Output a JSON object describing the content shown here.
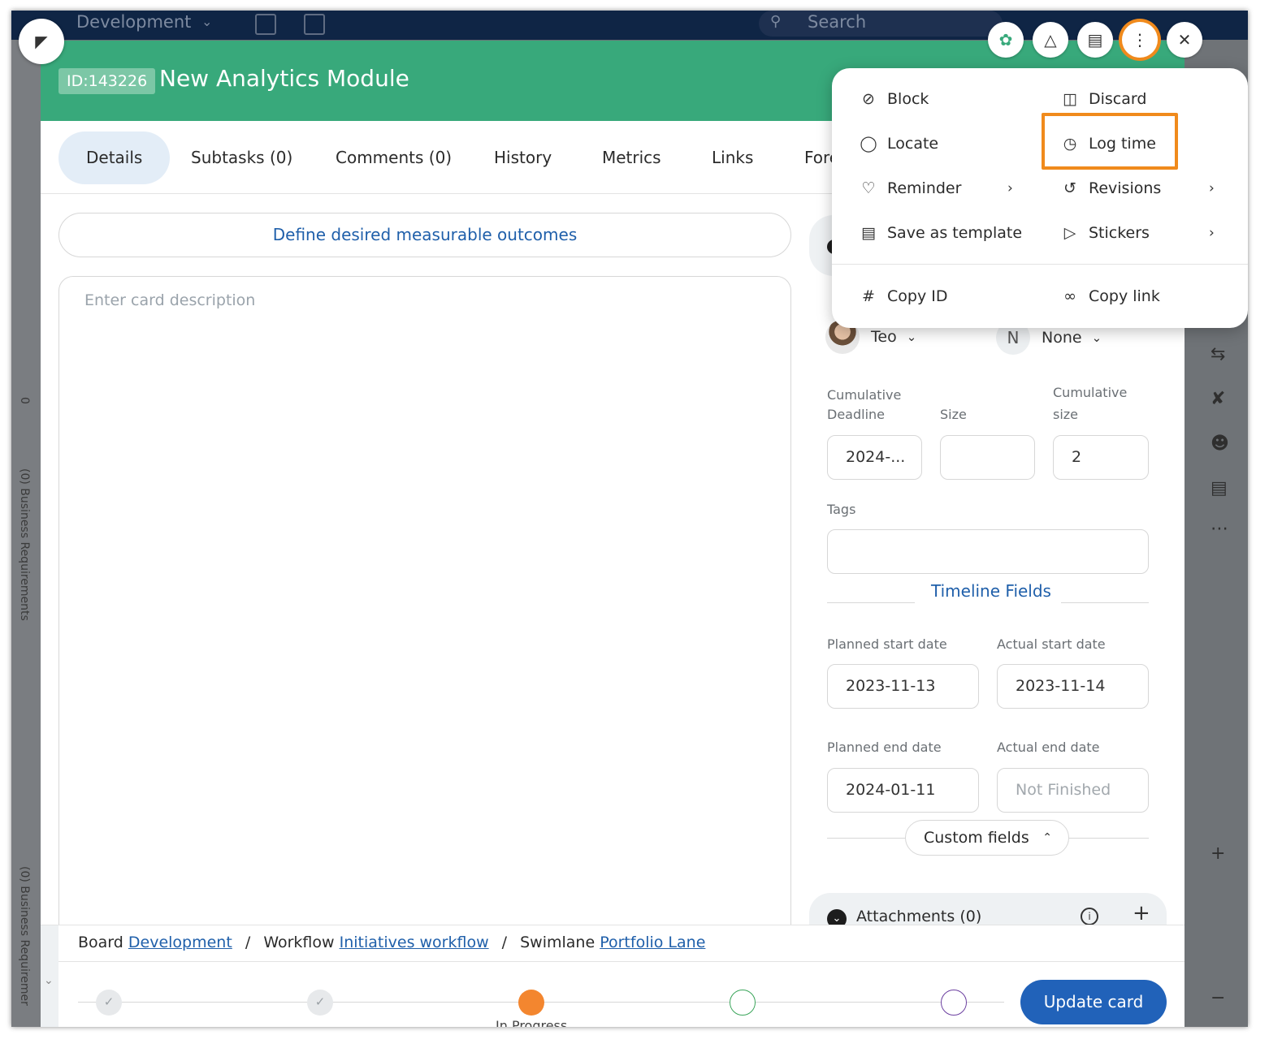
{
  "background": {
    "board_name": "Development",
    "search_placeholder": "Search",
    "left_column_labels": [
      "(0) Business Requirements",
      "(0) Business Requiremer"
    ],
    "left_column_count": "0"
  },
  "header": {
    "card_id": "ID:143226",
    "card_title": "New Analytics Module",
    "color": "#38a97b"
  },
  "tabs": [
    {
      "label": "Details",
      "active": true
    },
    {
      "label": "Subtasks (0)"
    },
    {
      "label": "Comments (0)"
    },
    {
      "label": "History"
    },
    {
      "label": "Metrics"
    },
    {
      "label": "Links"
    },
    {
      "label": "Fore"
    }
  ],
  "main": {
    "outcomes_button": "Define desired measurable outcomes",
    "description_placeholder": "Enter card description"
  },
  "right_panel": {
    "assignee_name": "Teo",
    "secondary_initial": "N",
    "secondary_value": "None",
    "deadline_label": "Deadline",
    "deadline_value": "2024-...",
    "size_label": "Size",
    "size_value": "",
    "cumulative_size_label_1": "Cumulative",
    "cumulative_size_label_2": "size",
    "cumulative_size_value": "2",
    "tags_label": "Tags",
    "timeline_title": "Timeline Fields",
    "planned_start_label": "Planned start date",
    "planned_start_value": "2023-11-13",
    "actual_start_label": "Actual start date",
    "actual_start_value": "2023-11-14",
    "planned_end_label": "Planned end date",
    "planned_end_value": "2024-01-11",
    "actual_end_label": "Actual end date",
    "actual_end_placeholder": "Not Finished",
    "custom_fields_label": "Custom fields",
    "attachments_label": "Attachments (0)"
  },
  "footer": {
    "board_label": "Board",
    "board_link": "Development",
    "workflow_label": "Workflow",
    "workflow_link": "Initiatives workflow",
    "swimlane_label": "Swimlane",
    "swimlane_link": "Portfolio Lane",
    "current_step_label": "In Progress",
    "update_button": "Update card"
  },
  "menu": {
    "block": "Block",
    "discard": "Discard",
    "locate": "Locate",
    "log_time": "Log time",
    "reminder": "Reminder",
    "revisions": "Revisions",
    "save_as_template": "Save as template",
    "stickers": "Stickers",
    "copy_id": "Copy ID",
    "copy_link": "Copy link"
  },
  "colors": {
    "accent_orange": "#f08a1c",
    "link_blue": "#1f5faa",
    "primary_button": "#2162b9"
  }
}
